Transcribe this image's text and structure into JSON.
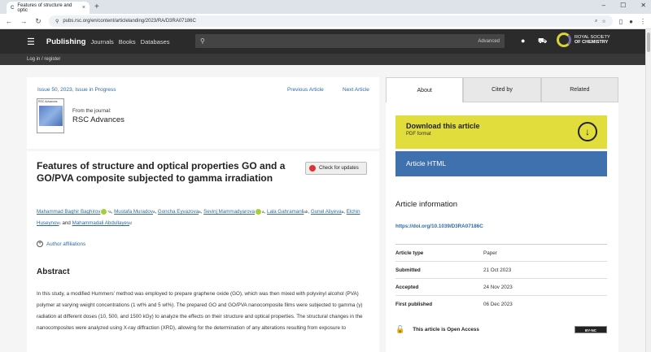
{
  "browser": {
    "tab_title": "Features of structure and optic",
    "url": "pubs.rsc.org/en/content/articlelanding/2023/RA/D3RA07186C"
  },
  "header": {
    "brand": "Publishing",
    "nav": [
      "Journals",
      "Books",
      "Databases"
    ],
    "search_advanced": "Advanced",
    "society_line1": "ROYAL SOCIETY",
    "society_line2": "OF CHEMISTRY",
    "login": "Log in / register"
  },
  "article": {
    "issue": "Issue 50, 2023, Issue in Progress",
    "prev": "Previous Article",
    "next": "Next Article",
    "from": "From the journal:",
    "journal": "RSC Advances",
    "cover_label": "RSC Advances",
    "title": "Features of structure and optical properties GO and a GO/PVA composite subjected to gamma irradiation",
    "check_updates": "Check for updates",
    "authors": [
      "Mahammad Baghir Baghirov",
      "Mustafa Muradov",
      "Goncha Eyvazova",
      "Sevinj Mammadyarova",
      "Lala Gahramanli",
      "Gunel Aliyeva",
      "Elchin Huseynov",
      "Mahammadali Abdullayev"
    ],
    "affil_sups": [
      "*a",
      "a",
      "a",
      "a",
      "ab",
      "a",
      "c",
      "d"
    ],
    "and": "and",
    "affiliations": "Author affiliations",
    "abstract_heading": "Abstract",
    "abstract": "In this study, a modified Hummers' method was employed to prepare graphene oxide (GO), which was then mixed with polyvinyl alcohol (PVA) polymer at varying weight concentrations (1 wt% and 5 wt%). The prepared GO and GO/PVA nanocomposite films were subjected to gamma (γ) radiation at different doses (10, 500, and 1500 kGy) to analyze the effects on their structure and optical properties. The structural changes in the nanocomposites were analyzed using X-ray diffraction (XRD), allowing for the determination of any alterations resulting from exposure to"
  },
  "side": {
    "tabs": [
      "About",
      "Cited by",
      "Related"
    ],
    "download_title": "Download this article",
    "download_sub": "PDF format",
    "html": "Article HTML",
    "info_heading": "Article information",
    "doi": "https://doi.org/10.1039/D3RA07186C",
    "info": [
      {
        "k": "Article type",
        "v": "Paper"
      },
      {
        "k": "Submitted",
        "v": "21 Oct 2023"
      },
      {
        "k": "Accepted",
        "v": "24 Nov 2023"
      },
      {
        "k": "First published",
        "v": "06 Dec 2023"
      }
    ],
    "oa": "This article is Open Access",
    "license": "BY-NC"
  }
}
